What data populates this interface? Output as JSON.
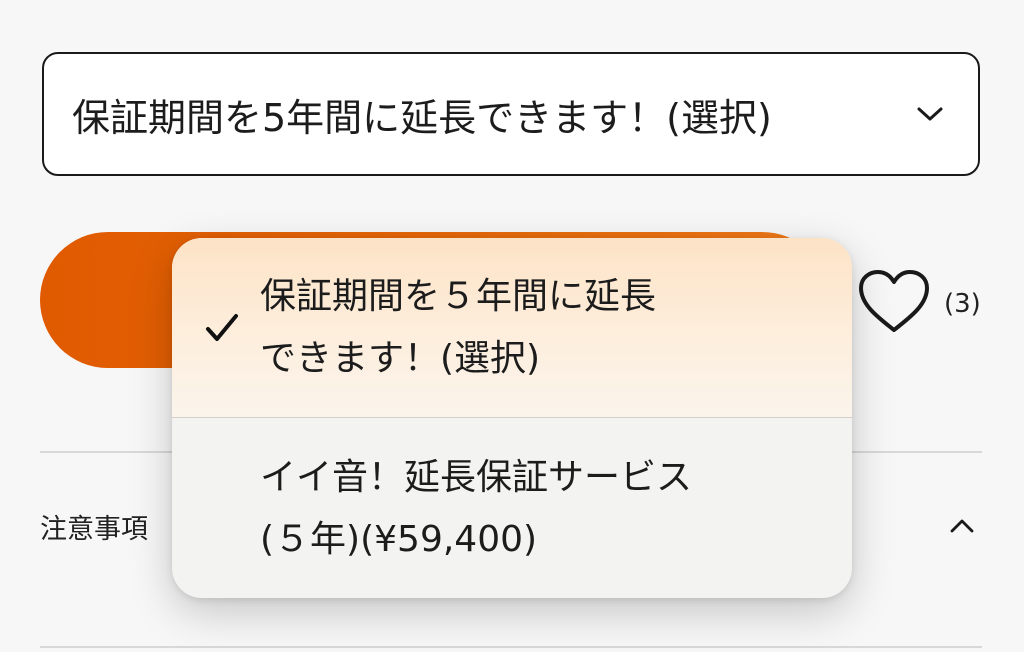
{
  "warranty_select": {
    "value": "保証期間を5年間に延長できます！(選択)",
    "chevron_icon": "chevron-down-icon"
  },
  "favorite": {
    "icon": "heart-outline-icon",
    "count": "(3)"
  },
  "notes": {
    "label": "注意事項",
    "chevron_icon": "chevron-up-icon"
  },
  "dropdown": {
    "options": [
      {
        "line1": "保証期間を５年間に延長",
        "line2": "できます！(選択)",
        "selected": true
      },
      {
        "line1": "イイ音！延長保証サービス",
        "line2": "(５年)(¥59,400)",
        "selected": false
      }
    ]
  },
  "colors": {
    "accent": "#e8650a",
    "selected_option_bg": "#fde6cc",
    "popup_bg": "#f3f3f1"
  }
}
